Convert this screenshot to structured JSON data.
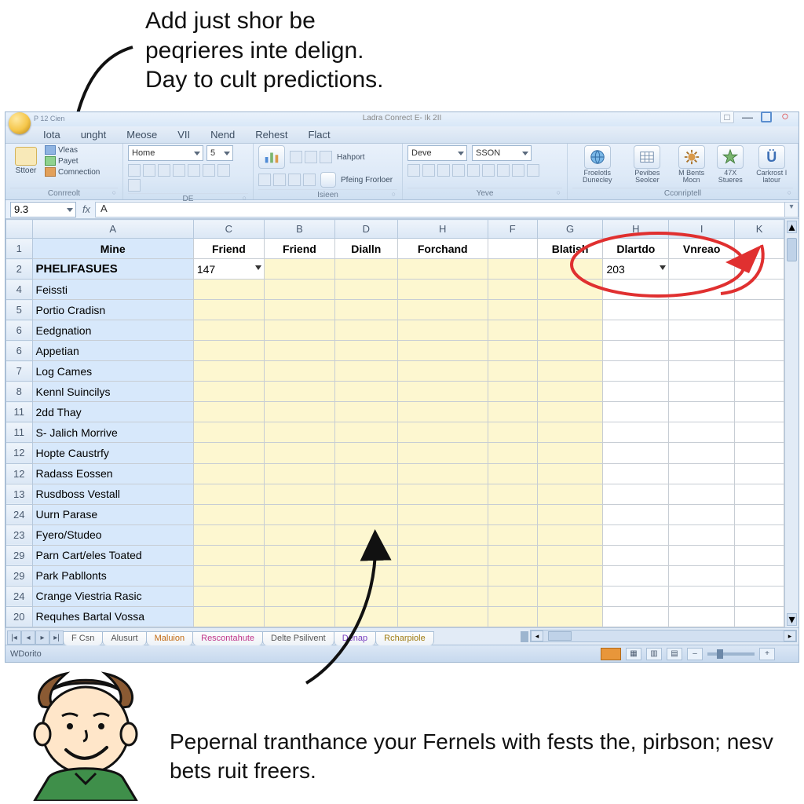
{
  "annotations": {
    "top": "Add just shor be\npeqrieres inte delign.\nDay to cult predictions.",
    "bottom": "Pepernal tranthance your Fernels with fests the, pirbson; nesv bets ruit freers."
  },
  "window": {
    "title_small": "P 12 Cien",
    "title_center": "Ladra Conrect E- Ik 2II",
    "win_dash": "□",
    "win_min": "―",
    "win_close": "○"
  },
  "menubar": [
    "Iota",
    "unght",
    "Meose",
    "VII",
    "Nend",
    "Rehest",
    "Flact"
  ],
  "ribbon": {
    "group1": {
      "big_label": "Sttoer",
      "lines": [
        "Vleas",
        "Payet",
        "Comnection"
      ],
      "label": "Conrreolt"
    },
    "group2": {
      "fontbox": "Home",
      "size": "5",
      "label": "DE"
    },
    "group3": {
      "btn": "Hahport",
      "btn2": "Pfeing Frorloer",
      "label": "Isieen"
    },
    "group4": {
      "sel1": "Deve",
      "sel2": "SSON",
      "label": "Yeve"
    },
    "group5": {
      "items": [
        {
          "cap": "Froelotls Dunecley"
        },
        {
          "cap": "Pevibes Seolcer"
        },
        {
          "cap": "M Bents Mocn"
        },
        {
          "cap": "47X Stueres"
        },
        {
          "cap": "Carkrost I latour"
        }
      ],
      "label": "Cconriptell"
    }
  },
  "formula": {
    "namebox": "9.3",
    "value": "A"
  },
  "columns": [
    "",
    "A",
    "C",
    "B",
    "D",
    "H",
    "F",
    "G",
    "H",
    "I",
    "K"
  ],
  "col_header_row": [
    "Mine",
    "Friend",
    "Friend",
    "Dialln",
    "Forchand",
    "",
    "Blatish",
    "Dlartdo",
    "Vnreao",
    ""
  ],
  "row_numbers": [
    "1",
    "2",
    "4",
    "5",
    "6",
    "6",
    "7",
    "8",
    "11",
    "11",
    "12",
    "12",
    "13",
    "24",
    "23",
    "29",
    "29",
    "24",
    "20"
  ],
  "colA_values": [
    "PHELIFASUES",
    "Feissti",
    "Portio Cradisn",
    "Eedgnation",
    "Appetian",
    "Log Cames",
    "Kennl Suincilys",
    "2dd Thay",
    "S- Jalich Morrive",
    "Hopte Caustrfy",
    "Radass Eossen",
    "Rusdboss Vestall",
    "Uurn Parase",
    "Fyero/Studeo",
    "Parn Cart/eles Toated",
    "Park Pabllonts",
    "Crange Viestria Rasic",
    "Requhes Bartal Vossa"
  ],
  "cell_c2": "147",
  "cell_h2": "203",
  "sheet_tabs": [
    {
      "label": "F Csn",
      "cls": "gray"
    },
    {
      "label": "Alusurt",
      "cls": "gray"
    },
    {
      "label": "Maluion",
      "cls": "orange"
    },
    {
      "label": "Rescontahute",
      "cls": "pink"
    },
    {
      "label": "Delte Psilivent",
      "cls": "gray"
    },
    {
      "label": "Dënap",
      "cls": "purple"
    },
    {
      "label": "Rcharpiole",
      "cls": "gold"
    }
  ],
  "statusbar": {
    "left": "WDorito"
  }
}
